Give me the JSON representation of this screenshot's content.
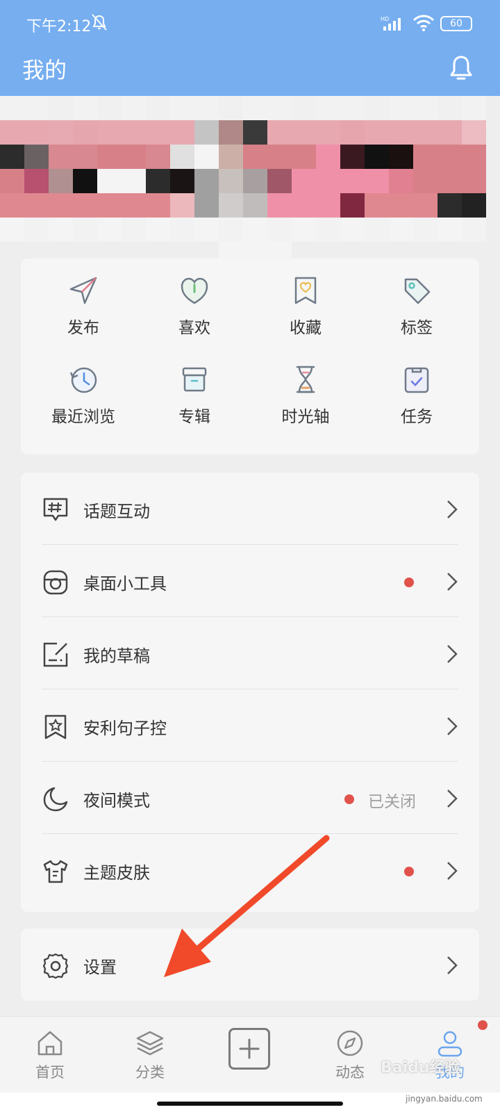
{
  "status_bar": {
    "time": "下午2:12",
    "battery": "60",
    "network_label": "HD"
  },
  "header": {
    "title": "我的"
  },
  "shortcuts": [
    {
      "label": "发布",
      "icon": "send-icon"
    },
    {
      "label": "喜欢",
      "icon": "heart-shield-icon"
    },
    {
      "label": "收藏",
      "icon": "bookmark-heart-icon"
    },
    {
      "label": "标签",
      "icon": "tag-icon"
    },
    {
      "label": "最近浏览",
      "icon": "history-icon"
    },
    {
      "label": "专辑",
      "icon": "album-box-icon"
    },
    {
      "label": "时光轴",
      "icon": "hourglass-icon"
    },
    {
      "label": "任务",
      "icon": "task-clipboard-icon"
    }
  ],
  "menu": [
    {
      "label": "话题互动",
      "icon": "hashtag-icon",
      "dot": false,
      "status": ""
    },
    {
      "label": "桌面小工具",
      "icon": "widget-icon",
      "dot": true,
      "status": ""
    },
    {
      "label": "我的草稿",
      "icon": "draft-edit-icon",
      "dot": false,
      "status": ""
    },
    {
      "label": "安利句子控",
      "icon": "star-bookmark-icon",
      "dot": false,
      "status": ""
    },
    {
      "label": "夜间模式",
      "icon": "moon-icon",
      "dot": true,
      "status": "已关闭"
    },
    {
      "label": "主题皮肤",
      "icon": "tshirt-icon",
      "dot": true,
      "status": ""
    }
  ],
  "settings": {
    "label": "设置",
    "icon": "gear-icon"
  },
  "bottom_nav": [
    {
      "label": "首页",
      "icon": "home-icon"
    },
    {
      "label": "分类",
      "icon": "layers-icon"
    },
    {
      "label": "",
      "icon": "add-icon"
    },
    {
      "label": "动态",
      "icon": "compass-icon"
    },
    {
      "label": "我的",
      "icon": "user-icon",
      "active": true
    }
  ],
  "watermark": {
    "text": "Baidu经验",
    "sub": "jingyan.baidu.com"
  },
  "colors": {
    "header": "#76aef0",
    "accent": "#6aa6ee",
    "badge": "#e0524a",
    "arrow": "#f04a2a"
  }
}
